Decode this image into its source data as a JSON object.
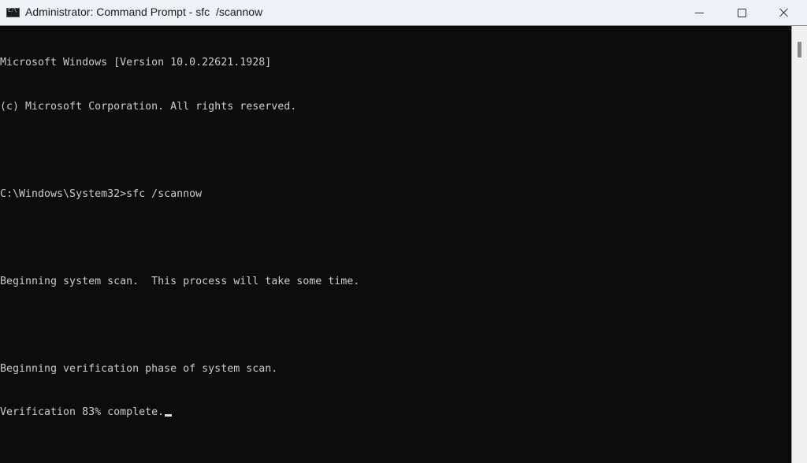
{
  "window": {
    "title": "Administrator: Command Prompt - sfc  /scannow",
    "app_icon": "command-prompt-icon",
    "controls": {
      "minimize": "minimize-icon",
      "maximize": "maximize-icon",
      "close": "close-icon"
    }
  },
  "console": {
    "lines": [
      "Microsoft Windows [Version 10.0.22621.1928]",
      "(c) Microsoft Corporation. All rights reserved.",
      "",
      "C:\\Windows\\System32>sfc /scannow",
      "",
      "Beginning system scan.  This process will take some time.",
      "",
      "Beginning verification phase of system scan.",
      "Verification 83% complete."
    ],
    "verification_progress_percent": 83,
    "cursor": "block-underline",
    "colors": {
      "background": "#0c0c0c",
      "foreground": "#cccccc"
    }
  }
}
